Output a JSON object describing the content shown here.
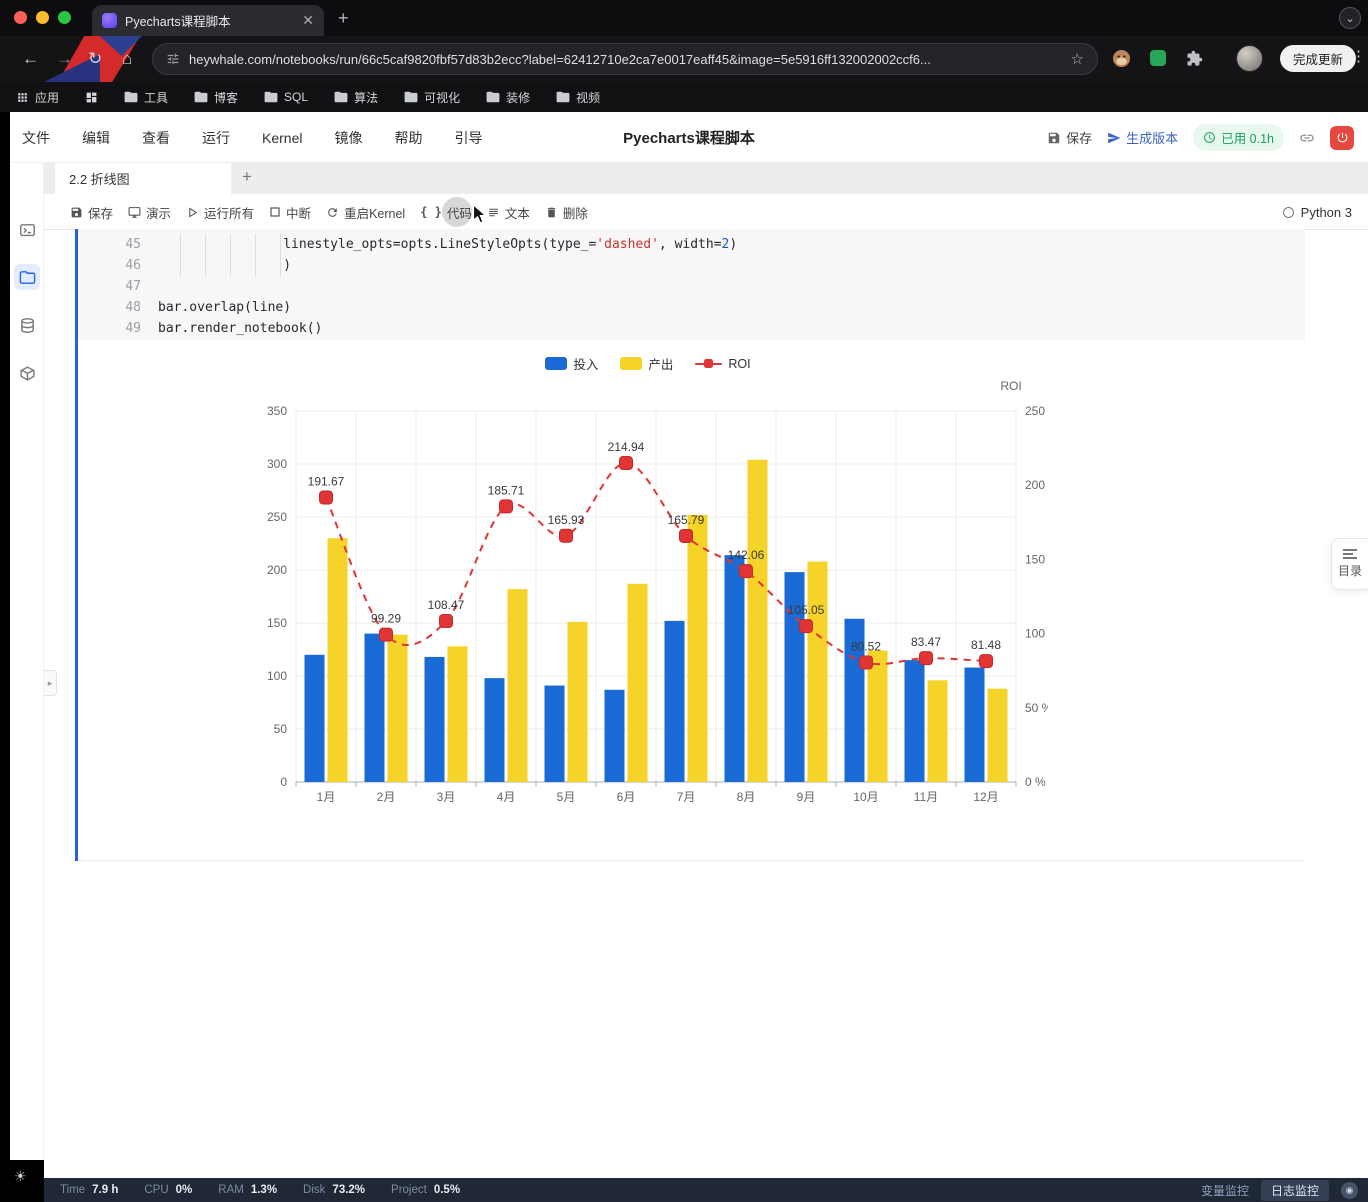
{
  "browser": {
    "tab_title": "Pyecharts课程脚本",
    "url": "heywhale.com/notebooks/run/66c5caf9820fbf57d83b2ecc?label=62412710e2ca7e0017eaff45&image=5e5916ff132002002ccf6...",
    "update_button": "完成更新",
    "bookmarks": {
      "apps_label": "应用",
      "folders": [
        "工具",
        "博客",
        "SQL",
        "算法",
        "可视化",
        "装修",
        "视频"
      ]
    }
  },
  "notebook": {
    "menu": [
      "文件",
      "编辑",
      "查看",
      "运行",
      "Kernel",
      "镜像",
      "帮助",
      "引导"
    ],
    "title": "Pyecharts课程脚本",
    "actions": {
      "save": "保存",
      "version": "生成版本",
      "usage": "已用 0.1h"
    },
    "tab": "2.2 折线图",
    "toolbar": [
      {
        "icon": "save",
        "label": "保存"
      },
      {
        "icon": "present",
        "label": "演示"
      },
      {
        "icon": "run",
        "label": "运行所有"
      },
      {
        "icon": "stop",
        "label": "中断"
      },
      {
        "icon": "restart",
        "label": "重启Kernel"
      },
      {
        "icon": "code",
        "label": "代码"
      },
      {
        "icon": "text",
        "label": "文本"
      },
      {
        "icon": "delete",
        "label": "删除"
      }
    ],
    "kernel": "Python 3",
    "toc": "目录"
  },
  "code": {
    "lines": [
      {
        "no": "45",
        "segs": [
          [
            "                linestyle_opts=opts.LineStyleOpts(type_=",
            "p"
          ],
          [
            "'dashed'",
            "s"
          ],
          [
            ", width=",
            "p"
          ],
          [
            "2",
            "n"
          ],
          [
            ")",
            "p"
          ]
        ]
      },
      {
        "no": "46",
        "segs": [
          [
            "                )",
            "p"
          ]
        ]
      },
      {
        "no": "47",
        "segs": []
      },
      {
        "no": "48",
        "segs": [
          [
            "bar.overlap(line)",
            "p"
          ]
        ]
      },
      {
        "no": "49",
        "segs": [
          [
            "bar.render_notebook()",
            "p"
          ]
        ]
      }
    ]
  },
  "chart_data": {
    "type": "bar",
    "categories": [
      "1月",
      "2月",
      "3月",
      "4月",
      "5月",
      "6月",
      "7月",
      "8月",
      "9月",
      "10月",
      "11月",
      "12月"
    ],
    "series": [
      {
        "name": "投入",
        "type": "bar",
        "color": "#1a6ad6",
        "axis": "left",
        "values": [
          120,
          140,
          118,
          98,
          91,
          87,
          152,
          214,
          198,
          154,
          115,
          108
        ]
      },
      {
        "name": "产出",
        "type": "bar",
        "color": "#f5d328",
        "axis": "left",
        "values": [
          230,
          139,
          128,
          182,
          151,
          187,
          252,
          304,
          208,
          124,
          96,
          88
        ]
      },
      {
        "name": "ROI",
        "type": "line",
        "color": "#e13434",
        "axis": "right",
        "values": [
          191.67,
          99.29,
          108.47,
          185.71,
          165.93,
          214.94,
          165.79,
          142.06,
          105.05,
          80.52,
          83.47,
          81.48
        ],
        "labels": [
          "191.67",
          "99.29",
          "108.47",
          "185.71",
          "165.93",
          "214.94",
          "165.79",
          "142.06",
          "105.05",
          "80.52",
          "83.47",
          "81.48"
        ]
      }
    ],
    "left_axis": {
      "min": 0,
      "max": 350,
      "step": 50
    },
    "right_axis": {
      "min": 0,
      "max": 250,
      "step": 50,
      "suffix": " %",
      "title": "ROI"
    },
    "legend": [
      "投入",
      "产出",
      "ROI"
    ],
    "legend_position": "top-center",
    "grid": true
  },
  "statusbar": {
    "metrics": [
      {
        "label": "Time",
        "value": "7.9 h"
      },
      {
        "label": "CPU",
        "value": "0%"
      },
      {
        "label": "RAM",
        "value": "1.3%"
      },
      {
        "label": "Disk",
        "value": "73.2%"
      },
      {
        "label": "Project",
        "value": "0.5%"
      }
    ],
    "monitors": [
      "变量监控",
      "日志监控"
    ]
  }
}
